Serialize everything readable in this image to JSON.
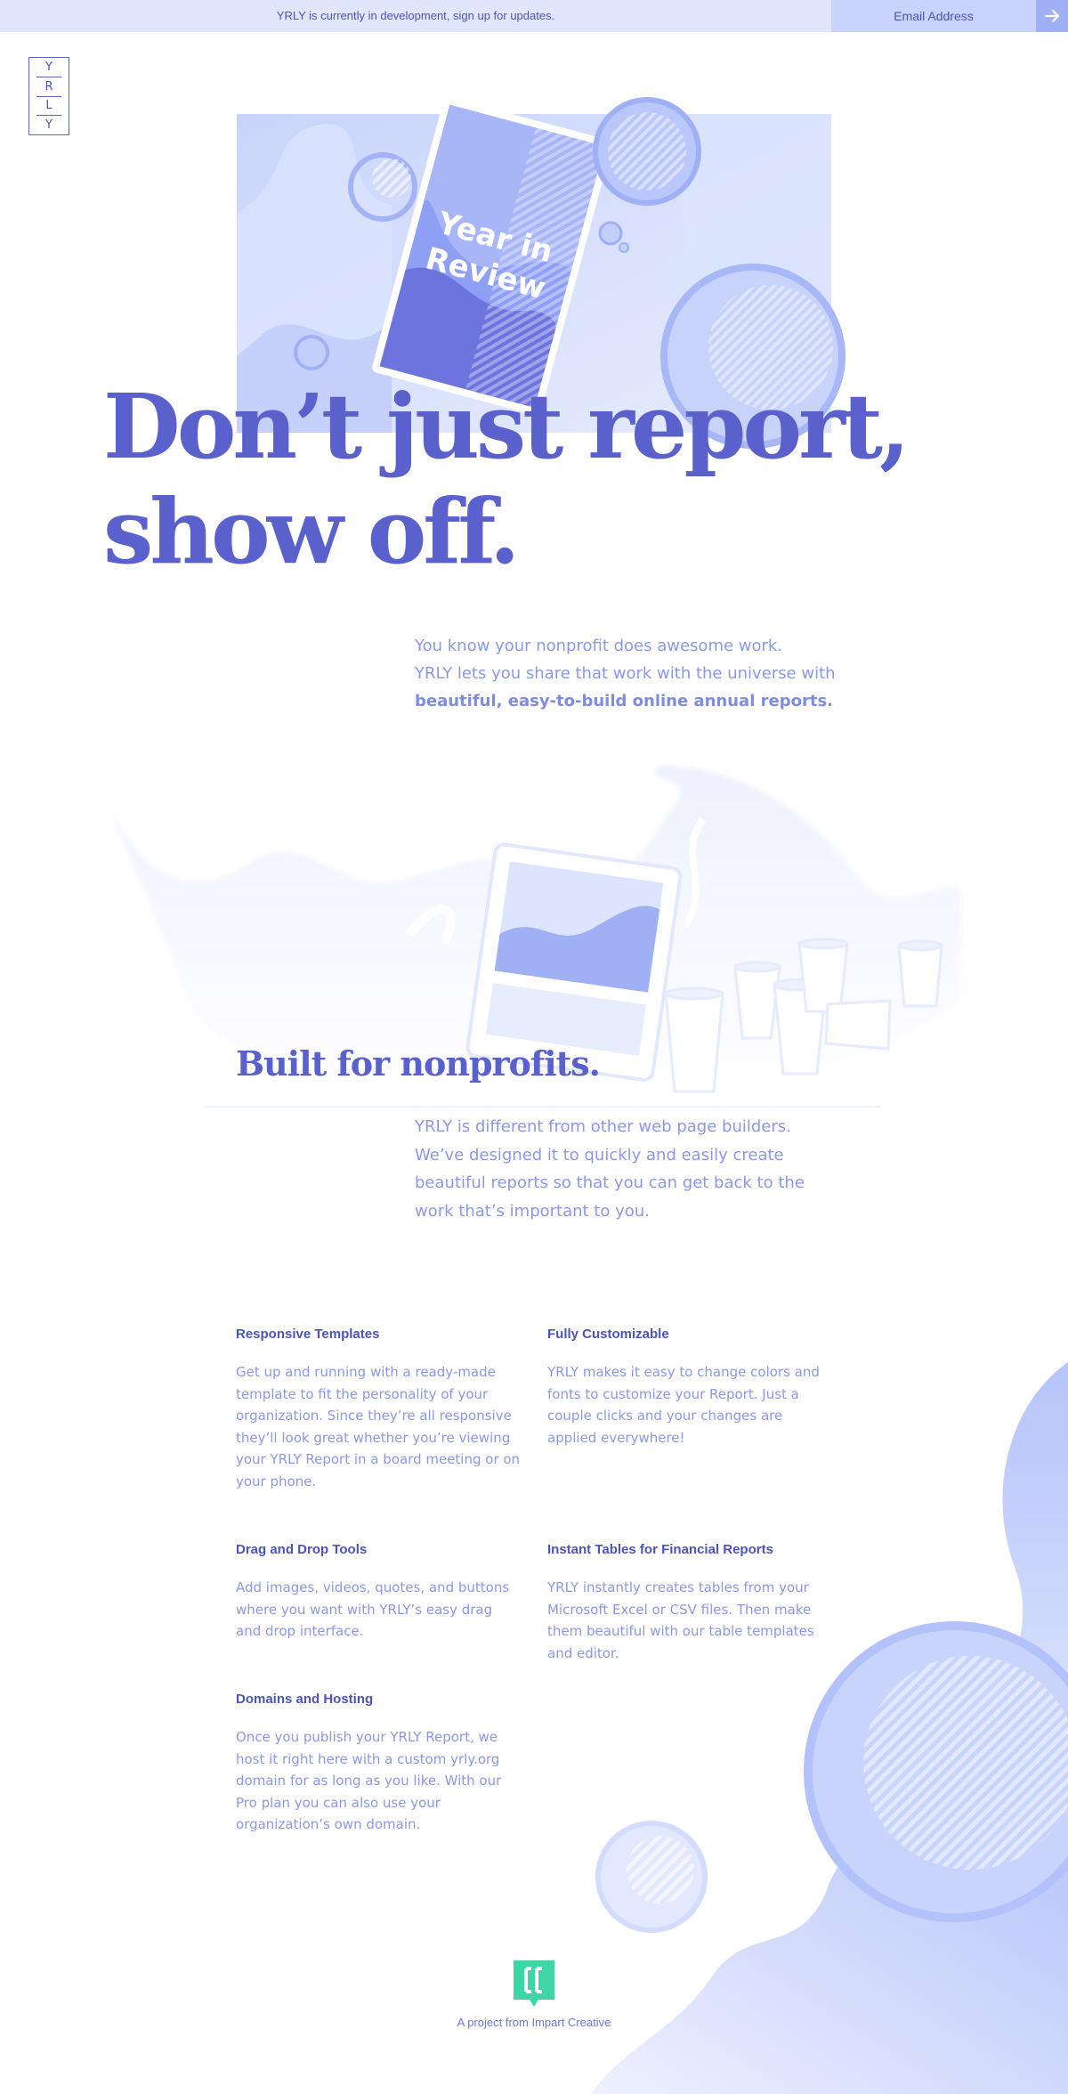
{
  "announcement": {
    "message": "YRLY is currently in development, sign up for updates.",
    "email_placeholder": "Email Address",
    "submit_icon": "arrow-right-icon"
  },
  "logo": {
    "letters": [
      "Y",
      "R",
      "L",
      "Y"
    ]
  },
  "hero": {
    "book_title_line1": "Year in",
    "book_title_line2": "Review",
    "headline_line1": "Don’t just report,",
    "headline_line2": "show off."
  },
  "intro": {
    "line1": "You know your nonprofit does awesome work.",
    "line2": "YRLY lets you share that work with the universe with",
    "line3": "beautiful, easy-to-build online annual reports."
  },
  "section": {
    "title": "Built for nonprofits.",
    "body": "YRLY is different from other web page builders. We’ve designed it to quickly and easily create beautiful reports so that you can get back to the work that’s important to you."
  },
  "features": [
    {
      "title": "Responsive Templates",
      "body": "Get up and running with a ready-made template to fit the personality of your organization. Since they’re all responsive they’ll look great whether you’re viewing your YRLY Report in a board meeting or on your phone."
    },
    {
      "title": "Fully Customizable",
      "body": "YRLY makes it easy to change colors and fonts to customize your Report. Just a couple clicks and your changes are applied everywhere!"
    },
    {
      "title": "Drag and Drop Tools",
      "body": "Add images, videos, quotes, and buttons where you want with YRLY’s easy drag and drop interface."
    },
    {
      "title": "Instant Tables for Financial Reports",
      "body": "YRLY instantly creates tables from your Microsoft Excel or CSV files. Then make them beautiful with our table templates and editor."
    },
    {
      "title": "Domains and Hosting",
      "body": "Once you publish your YRLY Report, we host it right here with a custom yrly.org domain for as long as you like. With our Pro plan you can also use your organization’s own domain."
    }
  ],
  "footer": {
    "text": "A project from Impart Creative",
    "icon": "impart-logo-icon"
  },
  "colors": {
    "brand_indigo": "#5a60cc",
    "body_text": "#8b98e6",
    "bar_bg": "#e0e6fc",
    "footer_icon": "#3dd6a4"
  }
}
